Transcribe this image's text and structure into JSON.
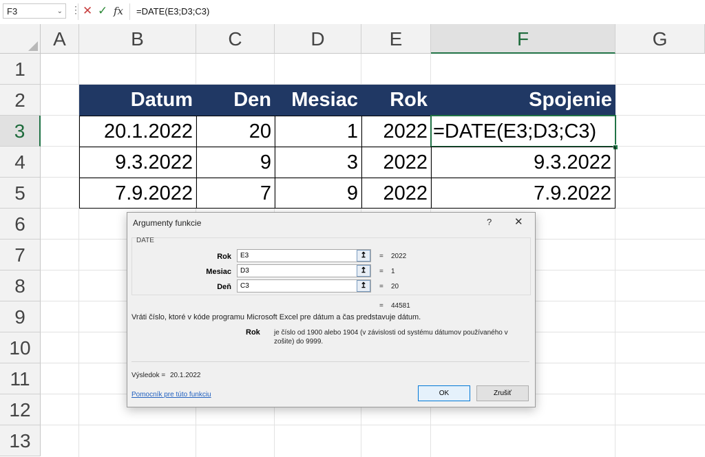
{
  "formula_bar": {
    "name_box": "F3",
    "dropdown_icon": "chevron-down-icon",
    "more_icon": "more-vertical-icon",
    "cancel_icon": "✕",
    "enter_icon": "✓",
    "fx_label": "fx",
    "formula": "=DATE(E3;D3;C3)"
  },
  "columns": [
    "A",
    "B",
    "C",
    "D",
    "E",
    "F",
    "G"
  ],
  "rows": [
    "1",
    "2",
    "3",
    "4",
    "5",
    "6",
    "7",
    "8",
    "9",
    "10",
    "11",
    "12",
    "13"
  ],
  "selection": {
    "cell": "F3",
    "column": "F",
    "row": "3"
  },
  "table": {
    "headers": [
      "Datum",
      "Den",
      "Mesiac",
      "Rok",
      "Spojenie"
    ],
    "header_bg": "#203864",
    "rows": [
      [
        "20.1.2022",
        "20",
        "1",
        "2022",
        "=DATE(E3;D3;C3)"
      ],
      [
        "9.3.2022",
        "9",
        "3",
        "2022",
        "9.3.2022"
      ],
      [
        "7.9.2022",
        "7",
        "9",
        "2022",
        "7.9.2022"
      ]
    ]
  },
  "dialog": {
    "title": "Argumenty funkcie",
    "help": "?",
    "close": "✕",
    "function_name": "DATE",
    "args": [
      {
        "label": "Rok",
        "value": "E3",
        "result": "2022"
      },
      {
        "label": "Mesiac",
        "value": "D3",
        "result": "1"
      },
      {
        "label": "Deň",
        "value": "C3",
        "result": "20"
      }
    ],
    "equals": "=",
    "collapse_icon": "↥",
    "total": "44581",
    "description": "Vráti číslo, ktoré v kóde programu Microsoft Excel pre dátum a čas predstavuje dátum.",
    "param_label": "Rok",
    "param_description": "je číslo od 1900 alebo 1904 (v závislosti od systému dátumov používaného v zošite) do 9999.",
    "result_label": "Výsledok =",
    "result_value": "20.1.2022",
    "help_link": "Pomocník pre túto funkciu",
    "ok": "OK",
    "cancel": "Zrušiť"
  }
}
